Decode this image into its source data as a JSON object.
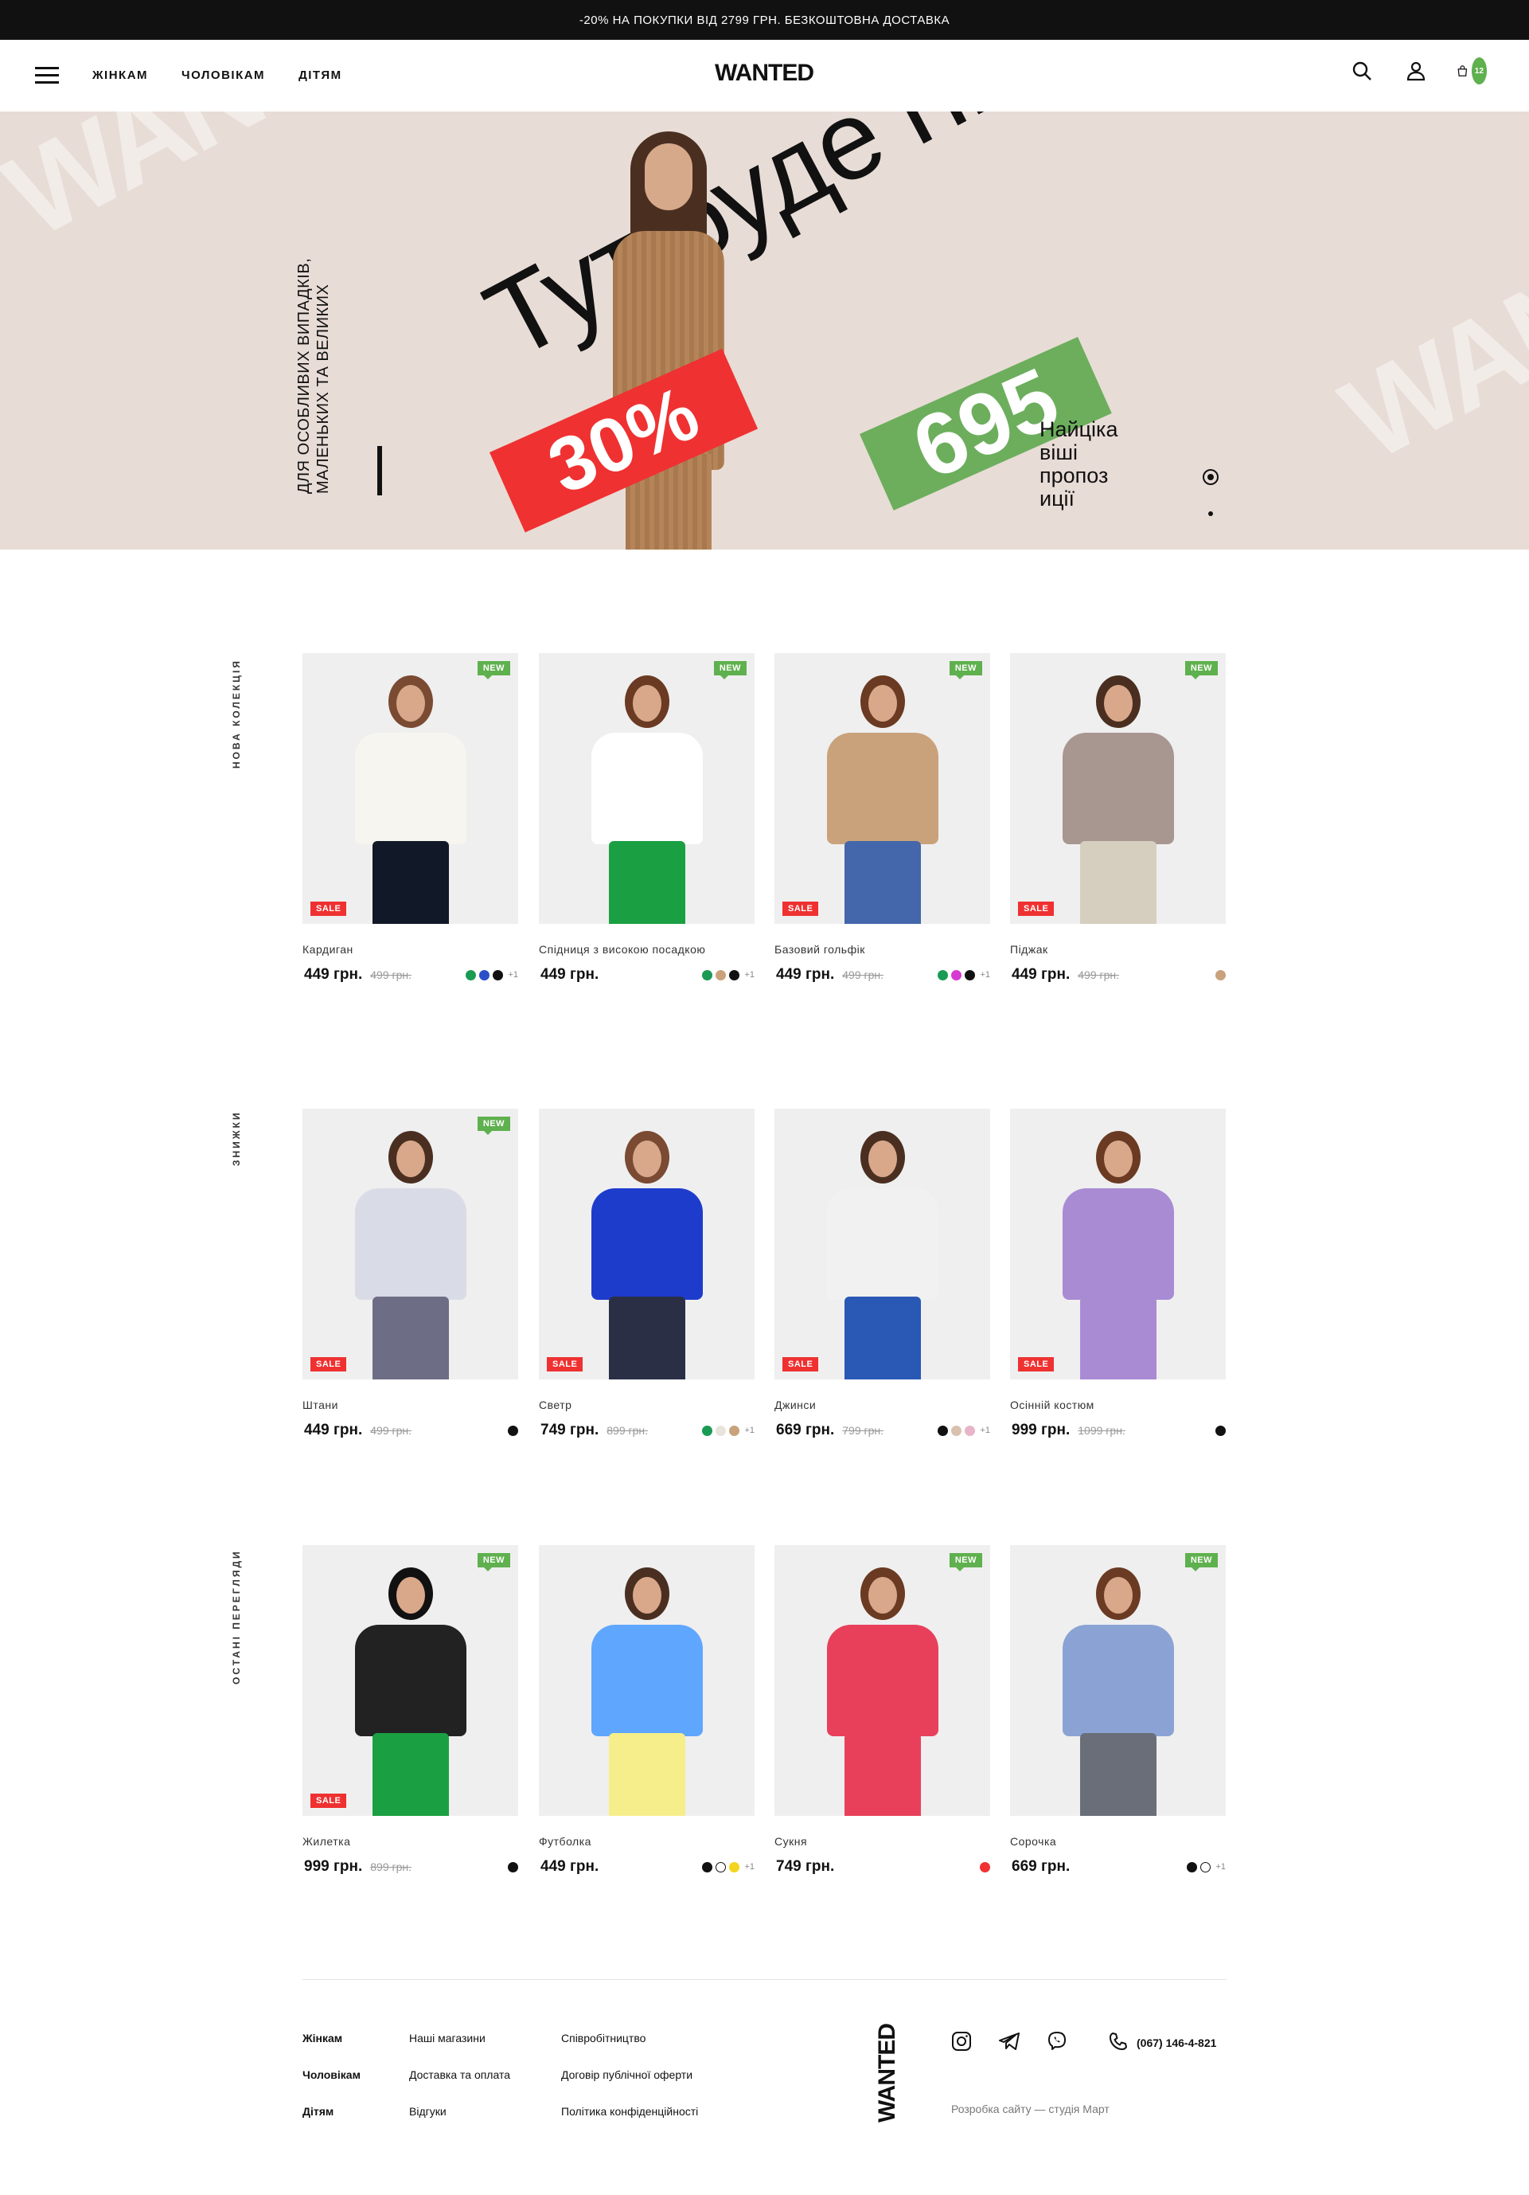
{
  "topbar": {
    "text": "-20% НА ПОКУПКИ ВІД 2799 ГРН. БЕЗКОШТОВНА ДОСТАВКА"
  },
  "header": {
    "logo": "WANTED",
    "nav": [
      "ЖІНКАМ",
      "ЧОЛОВІКАМ",
      "ДІТЯМ"
    ],
    "cart_count": "12",
    "icons": [
      "menu-icon",
      "search-icon",
      "user-icon",
      "cart-icon"
    ]
  },
  "hero": {
    "watermark": "WANTED",
    "side_text": "ДЛЯ ОСОБЛИВИХ ВИПАДКІВ, МАЛЕНЬКИХ ТА ВЕЛИКИХ",
    "big_text": "Тут буде гігантичес кий текст",
    "tag_red": "30%",
    "tag_green": "695",
    "promo": "Найціка віші пропоз иції"
  },
  "sections": [
    {
      "title": "НОВА КОЛЕКЦІЯ",
      "products": [
        {
          "name": "Кардиган",
          "price": "449 грн.",
          "old": "499 грн.",
          "new": true,
          "sale": true,
          "swatches": [
            "#1a9b54",
            "#2a4fc9",
            "#111111"
          ],
          "more": "+1"
        },
        {
          "name": "Спідниця з високою посадкою",
          "price": "449 грн.",
          "old": "",
          "new": true,
          "sale": false,
          "swatches": [
            "#1a9b54",
            "#c9a27b",
            "#111111"
          ],
          "more": "+1"
        },
        {
          "name": "Базовий гольфік",
          "price": "449 грн.",
          "old": "499 грн.",
          "new": true,
          "sale": true,
          "swatches": [
            "#1a9b54",
            "#d63ad3",
            "#111111"
          ],
          "more": "+1"
        },
        {
          "name": "Піджак",
          "price": "449 грн.",
          "old": "499 грн.",
          "new": true,
          "sale": true,
          "swatches": [
            "#c9a27b"
          ],
          "more": ""
        }
      ]
    },
    {
      "title": "ЗНИЖКИ",
      "products": [
        {
          "name": "Штани",
          "price": "449 грн.",
          "old": "499 грн.",
          "new": true,
          "sale": true,
          "swatches": [
            "#111111"
          ],
          "more": ""
        },
        {
          "name": "Светр",
          "price": "749 грн.",
          "old": "899 грн.",
          "new": false,
          "sale": true,
          "swatches": [
            "#1a9b54",
            "#e8e4dc",
            "#c9a27b"
          ],
          "more": "+1"
        },
        {
          "name": "Джинси",
          "price": "669 грн.",
          "old": "799 грн.",
          "new": false,
          "sale": true,
          "swatches": [
            "#111111",
            "#d8c2ae",
            "#e8b4c8"
          ],
          "more": "+1"
        },
        {
          "name": "Осінній костюм",
          "price": "999 грн.",
          "old": "1099 грн.",
          "new": false,
          "sale": true,
          "swatches": [
            "#111111"
          ],
          "more": ""
        }
      ]
    },
    {
      "title": "ОСТАНІ ПЕРЕГЛЯДИ",
      "products": [
        {
          "name": "Жилетка",
          "price": "999 грн.",
          "old": "899 грн.",
          "new": true,
          "sale": true,
          "swatches": [
            "#111111"
          ],
          "more": ""
        },
        {
          "name": "Футболка",
          "price": "449 грн.",
          "old": "",
          "new": false,
          "sale": false,
          "swatches": [
            "#111111",
            "#ffffff",
            "#f2d51c"
          ],
          "more": "+1"
        },
        {
          "name": "Сукня",
          "price": "749 грн.",
          "old": "",
          "new": true,
          "sale": false,
          "swatches": [
            "#ef3131"
          ],
          "more": ""
        },
        {
          "name": "Сорочка",
          "price": "669 грн.",
          "old": "",
          "new": true,
          "sale": false,
          "swatches": [
            "#111111",
            "#ffffff"
          ],
          "more": "+1"
        }
      ]
    }
  ],
  "badges": {
    "new": "NEW",
    "sale": "SALE"
  },
  "footer": {
    "col1": [
      "Жінкам",
      "Чоловікам",
      "Дітям"
    ],
    "col2": [
      "Наші магазини",
      "Доставка та оплата",
      "Відгуки"
    ],
    "col3": [
      "Співробітництво",
      "Договір публічної оферти",
      "Політика конфіденційності"
    ],
    "logo": "WANTED",
    "phone": "(067) 146-4-821",
    "credit": "Розробка сайту — студія Март",
    "social": [
      "instagram-icon",
      "telegram-icon",
      "viber-icon"
    ]
  }
}
